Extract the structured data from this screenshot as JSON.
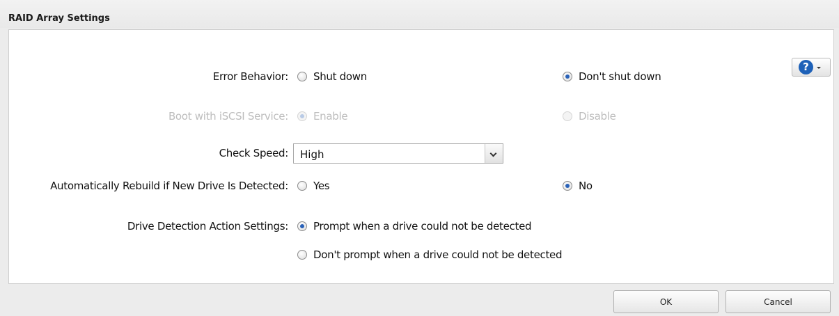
{
  "window": {
    "title": "RAID Array Settings"
  },
  "help": {
    "icon": "help-icon",
    "label": "?"
  },
  "settings": {
    "error_behavior": {
      "label": "Error Behavior:",
      "options": [
        "Shut down",
        "Don't shut down"
      ],
      "selected": "Don't shut down"
    },
    "boot_iscsi": {
      "label": "Boot with iSCSI Service:",
      "options": [
        "Enable",
        "Disable"
      ],
      "selected": "Enable",
      "disabled": true
    },
    "check_speed": {
      "label": "Check Speed:",
      "value": "High"
    },
    "auto_rebuild": {
      "label": "Automatically Rebuild if New Drive Is Detected:",
      "options": [
        "Yes",
        "No"
      ],
      "selected": "No"
    },
    "drive_detection": {
      "label": "Drive Detection Action Settings:",
      "options": [
        "Prompt when a drive could not be detected",
        "Don't prompt when a drive could not be detected"
      ],
      "selected": "Prompt when a drive could not be detected"
    }
  },
  "buttons": {
    "ok": "OK",
    "cancel": "Cancel"
  },
  "colors": {
    "accent": "#2a62b8",
    "help_blue": "#1e61b8"
  }
}
